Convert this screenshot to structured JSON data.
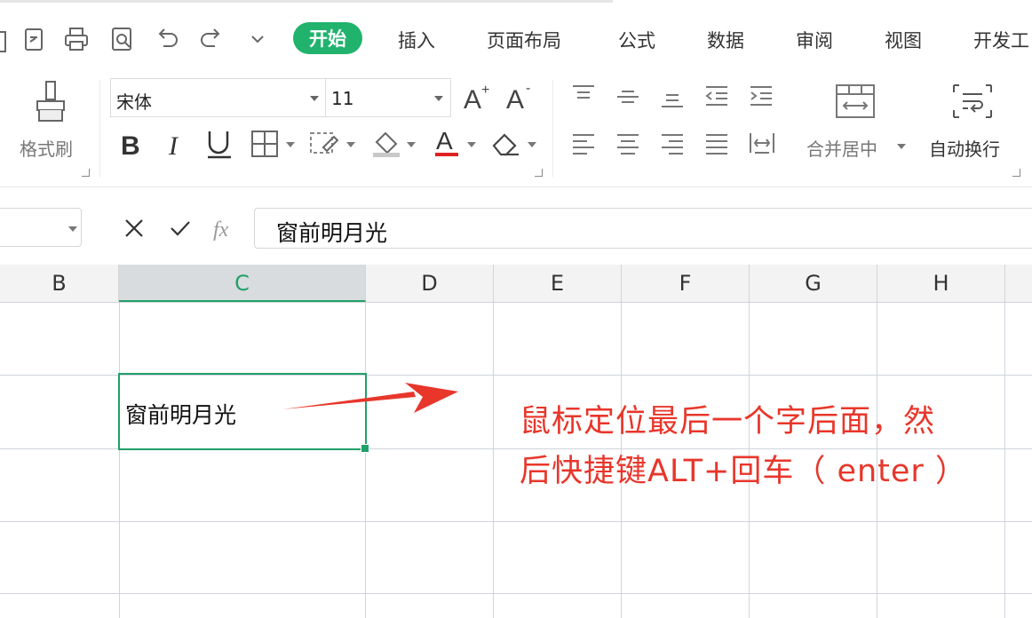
{
  "quick_access": [
    "clipboard-icon",
    "print-icon",
    "print-preview-icon",
    "undo-icon",
    "redo-icon",
    "more-icon"
  ],
  "tabs": [
    {
      "label": "开始",
      "active": true
    },
    {
      "label": "插入"
    },
    {
      "label": "页面布局"
    },
    {
      "label": "公式"
    },
    {
      "label": "数据"
    },
    {
      "label": "审阅"
    },
    {
      "label": "视图"
    },
    {
      "label": "开发工"
    }
  ],
  "ribbon": {
    "format_painter_label": "格式刷",
    "font_name": "宋体",
    "font_size": "11",
    "merge_label": "合并居中",
    "wrap_label": "自动换行",
    "font_color": "#e02020"
  },
  "formula_bar": {
    "cancel": "×",
    "confirm": "✓",
    "fx": "fx",
    "value": "窗前明月光"
  },
  "columns": [
    "B",
    "C",
    "D",
    "E",
    "F",
    "G",
    "H"
  ],
  "selected_column": "C",
  "active_cell_text": "窗前明月光",
  "annotation": {
    "line1": "鼠标定位最后一个字后面，然",
    "line2": "后快捷键ALT+回车（ enter ）",
    "color": "#e8362b"
  },
  "colors": {
    "accent": "#21a06a",
    "tab_active": "#21b36d"
  }
}
